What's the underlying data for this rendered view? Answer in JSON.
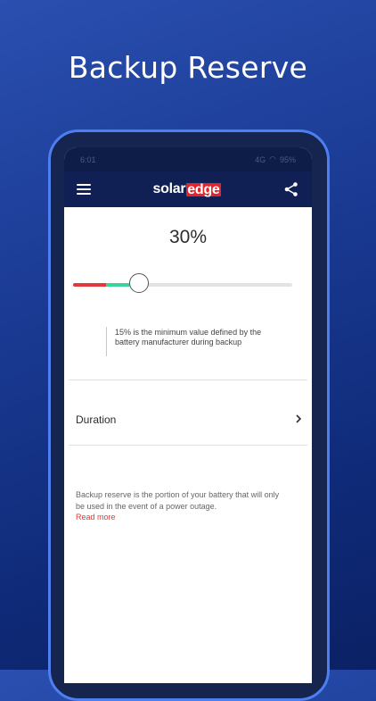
{
  "promo": {
    "title": "Backup Reserve"
  },
  "statusbar": {
    "time": "6:01",
    "signal": "4G",
    "battery": "95%"
  },
  "appbar": {
    "logo_solar": "solar",
    "logo_edge": "edge"
  },
  "backup": {
    "percent_text": "30%",
    "slider": {
      "value_percent": 30,
      "minimum_percent": 15
    },
    "min_note": "15% is the minimum value defined by the battery manufacturer during backup"
  },
  "duration": {
    "label": "Duration"
  },
  "info": {
    "text": "Backup reserve is the portion of your battery that will only be used in the event of a power outage.",
    "read_more": "Read more"
  },
  "colors": {
    "accent_red": "#e23a3a",
    "accent_green": "#3fd29a",
    "appbar": "#102055"
  }
}
